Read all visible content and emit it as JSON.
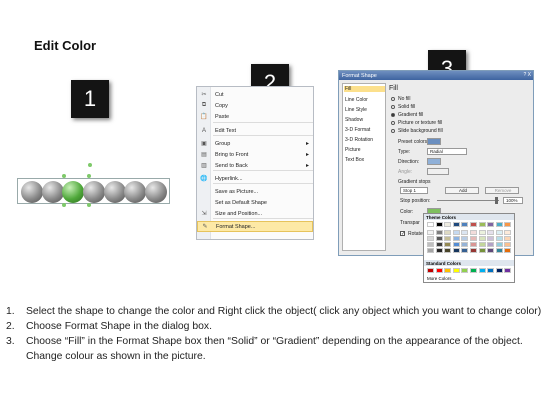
{
  "title": "Edit Color",
  "badges": [
    "1",
    "2",
    "3"
  ],
  "context_menu": {
    "items": [
      {
        "icon": "cut-icon",
        "label": "Cut",
        "glyph": "✂",
        "arrow": false
      },
      {
        "icon": "copy-icon",
        "label": "Copy",
        "glyph": "⧉",
        "arrow": false
      },
      {
        "icon": "paste-icon",
        "label": "Paste",
        "glyph": "📋",
        "arrow": false
      },
      {
        "icon": "edit-text-icon",
        "label": "Edit Text",
        "glyph": "A",
        "arrow": false
      },
      {
        "icon": "group-icon",
        "label": "Group",
        "glyph": "▣",
        "arrow": true
      },
      {
        "icon": "bring-to-front-icon",
        "label": "Bring to Front",
        "glyph": "▤",
        "arrow": true
      },
      {
        "icon": "send-to-back-icon",
        "label": "Send to Back",
        "glyph": "▥",
        "arrow": true
      },
      {
        "icon": "hyperlink-icon",
        "label": "Hyperlink...",
        "glyph": "🌐",
        "arrow": false
      },
      {
        "icon": "save-as-picture-icon",
        "label": "Save as Picture...",
        "glyph": "",
        "arrow": false
      },
      {
        "icon": "default-shape-icon",
        "label": "Set as Default Shape",
        "glyph": "",
        "arrow": false
      },
      {
        "icon": "size-position-icon",
        "label": "Size and Position...",
        "glyph": "⇲",
        "arrow": false
      },
      {
        "icon": "format-shape-icon",
        "label": "Format Shape...",
        "glyph": "✎",
        "arrow": false
      }
    ]
  },
  "dialog": {
    "title": "Format Shape",
    "title_buttons": "? X",
    "categories": [
      "Fill",
      "Line Color",
      "Line Style",
      "Shadow",
      "3-D Format",
      "3-D Rotation",
      "Picture",
      "Text Box"
    ],
    "pane_heading": "Fill",
    "fill_options": [
      "No fill",
      "Solid fill",
      "Gradient fill",
      "Picture or texture fill",
      "Slide background fill"
    ],
    "preset_label": "Preset colors:",
    "type_label": "Type:",
    "type_value": "Radial",
    "direction_label": "Direction:",
    "angle_label": "Angle:",
    "gradient_stops_label": "Gradient stops",
    "stop_value": "Stop 1",
    "add_label": "Add",
    "remove_label": "Remove",
    "stop_position_label": "Stop position:",
    "stop_position_value": "100%",
    "color_label": "Color:",
    "transparency_label": "Transpar",
    "rotate_label": "Rotate"
  },
  "color_picker": {
    "theme_label": "Theme Colors",
    "standard_label": "Standard Colors",
    "more_label": "More Colors...",
    "theme_top": [
      "#ffffff",
      "#000000",
      "#eeece1",
      "#1f497d",
      "#4f81bd",
      "#c0504d",
      "#9bbb59",
      "#8064a2",
      "#4bacc6",
      "#f79646"
    ],
    "theme_tint_1": [
      "#f2f2f2",
      "#7f7f7f",
      "#ddd9c3",
      "#c6d9f0",
      "#dbe5f1",
      "#f2dcdb",
      "#ebf1dd",
      "#e5e0ec",
      "#dbeef3",
      "#fdeada"
    ],
    "theme_tint_2": [
      "#d8d8d8",
      "#595959",
      "#c4bd97",
      "#8db3e2",
      "#b8cce4",
      "#e5b9b7",
      "#d7e3bc",
      "#ccc1d9",
      "#b7dde8",
      "#fbd5b5"
    ],
    "theme_tint_3": [
      "#bfbfbf",
      "#3f3f3f",
      "#938953",
      "#548dd4",
      "#95b3d7",
      "#d99694",
      "#c3d69b",
      "#b2a2c7",
      "#92cddc",
      "#fac08f"
    ],
    "theme_tint_4": [
      "#a5a5a5",
      "#262626",
      "#494429",
      "#17365d",
      "#366092",
      "#953734",
      "#76923c",
      "#5f497a",
      "#31859b",
      "#e36c09"
    ],
    "standard": [
      "#c00000",
      "#ff0000",
      "#ffc000",
      "#ffff00",
      "#92d050",
      "#00b050",
      "#00b0f0",
      "#0070c0",
      "#002060",
      "#7030a0"
    ]
  },
  "instructions": [
    {
      "num": "1.",
      "text": "Select the shape to change the color and Right click the object( click any object which you want to change color)"
    },
    {
      "num": "2.",
      "text": "Choose Format Shape in the dialog box."
    },
    {
      "num": "3.",
      "text": "Choose “Fill” in the Format Shape box then “Solid” or “Gradient” depending on the appearance of the object. Change colour as shown in the picture."
    }
  ]
}
